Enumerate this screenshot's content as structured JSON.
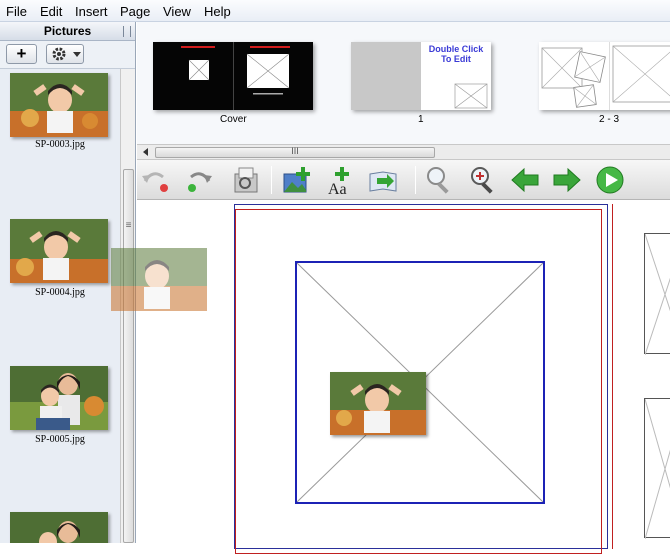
{
  "menu": [
    "File",
    "Edit",
    "Insert",
    "Page",
    "View",
    "Help"
  ],
  "sidebar": {
    "title": "Pictures",
    "add_label": "+",
    "pictures": [
      {
        "file": "SP-0003.jpg"
      },
      {
        "file": "SP-0004.jpg"
      },
      {
        "file": "SP-0005.jpg"
      },
      {
        "file": ""
      }
    ]
  },
  "strip": {
    "pages": [
      {
        "label": "Cover"
      },
      {
        "label": "1",
        "hint": "Double Click\nTo Edit"
      },
      {
        "label": "2 - 3"
      }
    ]
  },
  "hscroll_grip": "III",
  "vscroll_grip": "≡",
  "toolbar_tools": [
    "undo-icon",
    "redo-icon",
    "print-preview-icon",
    "add-picture-icon",
    "add-text-icon",
    "export-icon",
    "zoom-out-icon",
    "zoom-in-icon",
    "previous-page-icon",
    "next-page-icon",
    "play-icon"
  ],
  "colors": {
    "accent_blue": "#1c22b5",
    "bleed_red": "#c02020",
    "arrow_green": "#3aa53a"
  }
}
